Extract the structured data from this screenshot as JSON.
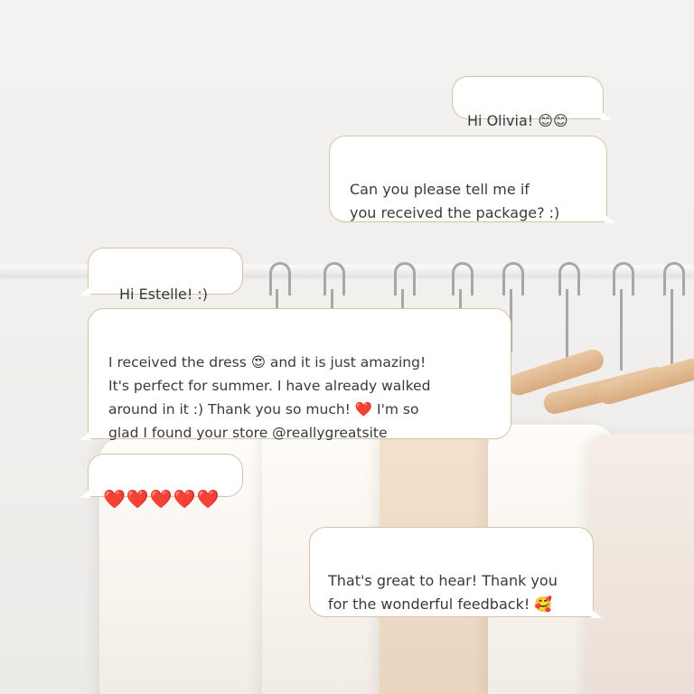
{
  "messages": [
    {
      "id": "m1",
      "side": "right",
      "text": "Hi Olivia! 😊😊"
    },
    {
      "id": "m2",
      "side": "right",
      "text": "Can you please tell me if\nyou received the package? :)"
    },
    {
      "id": "m3",
      "side": "left",
      "text": "Hi Estelle! :)"
    },
    {
      "id": "m4",
      "side": "left",
      "text": "I received the dress 😍 and it is just amazing!\nIt's perfect for summer. I have already walked\naround in it :) Thank you so much! ❤️ I'm so\nglad I found your store @reallygreatsite"
    },
    {
      "id": "m5",
      "side": "left",
      "text": "❤️❤️❤️❤️❤️"
    },
    {
      "id": "m6",
      "side": "right",
      "text": "That's great to hear! Thank you\nfor the wonderful feedback! 🥰"
    }
  ],
  "colors": {
    "bubble_bg": "#ffffff",
    "bubble_border": "#d7c1a8",
    "text": "#3a3a3a",
    "background": "#f1f0ee",
    "hanger_wood": "#dcb58a"
  }
}
